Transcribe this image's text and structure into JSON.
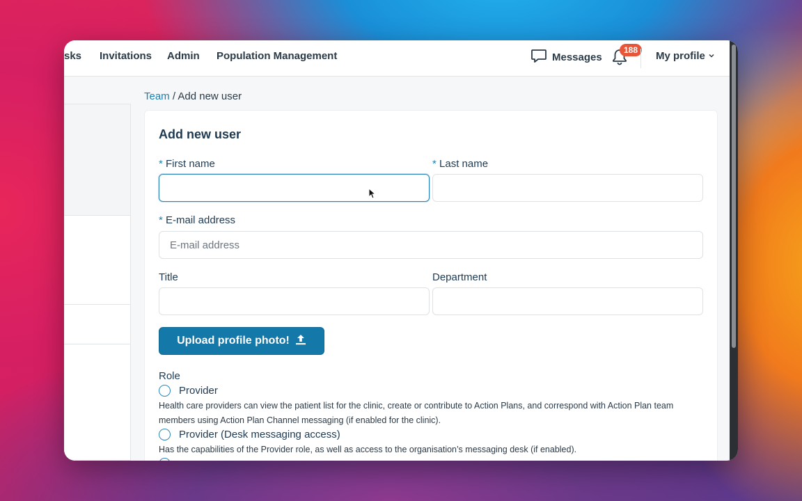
{
  "nav": {
    "items": [
      "sks",
      "Invitations",
      "Admin",
      "Population Management"
    ],
    "messages_label": "Messages",
    "notifications_count": "188",
    "profile_label": "My profile"
  },
  "breadcrumb": {
    "parent": "Team",
    "separator": " / ",
    "current": "Add new user"
  },
  "form": {
    "title": "Add new user",
    "required_marker": "*",
    "first_name_label": "First name",
    "first_name_value": "",
    "last_name_label": "Last name",
    "last_name_value": "",
    "email_label": "E-mail address",
    "email_placeholder": "E-mail address",
    "title_label": "Title",
    "department_label": "Department",
    "upload_label": "Upload profile photo!",
    "role_label": "Role",
    "roles": [
      {
        "name": "Provider",
        "description": "Health care providers can view the patient list for the clinic, create or contribute to Action Plans, and correspond with Action Plan team members using Action Plan Channel messaging (if enabled for the clinic)."
      },
      {
        "name": "Provider (Desk messaging access)",
        "description": "Has the capabilities of the Provider role, as well as access to the organisation’s messaging desk (if enabled)."
      }
    ]
  },
  "colors": {
    "accent": "#1478a8",
    "link": "#1d7fb0",
    "badge": "#e8563a",
    "text": "#1e3a52"
  },
  "icons": {
    "messages": "speech-bubble-icon",
    "notifications": "bell-icon",
    "profile_dropdown": "chevron-down-icon",
    "upload": "upload-icon"
  }
}
